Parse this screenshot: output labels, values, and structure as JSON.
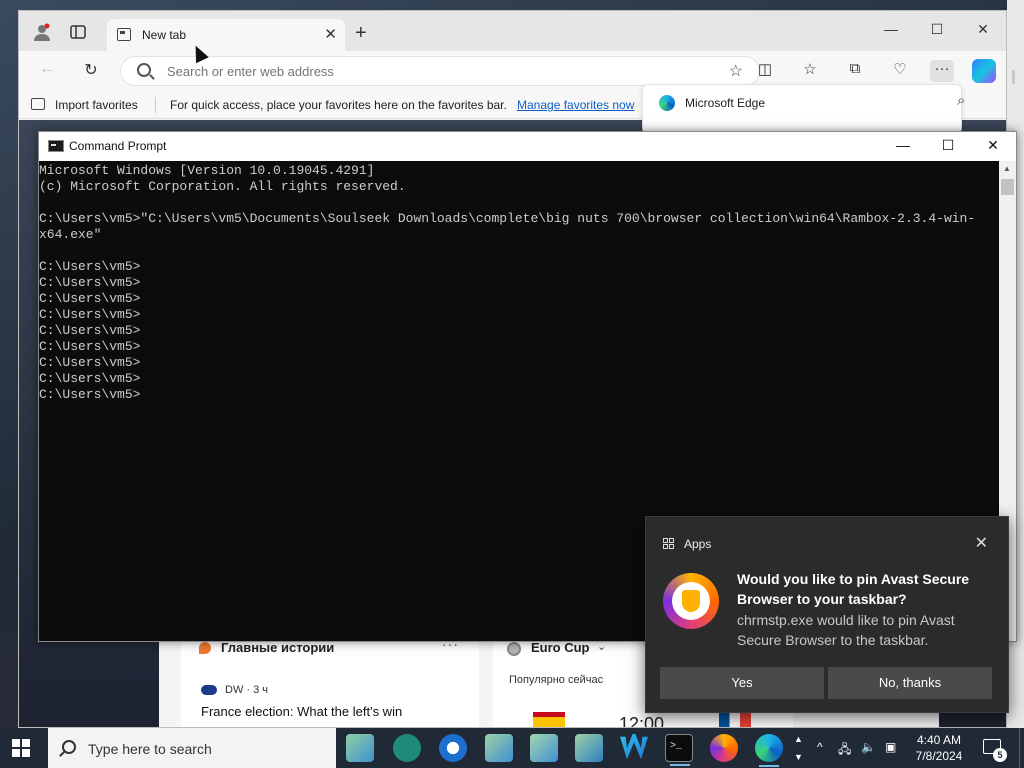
{
  "browser": {
    "tab_title": "New tab",
    "address_placeholder": "Search or enter web address",
    "import_favorites": "Import favorites",
    "favbar_hint": "For quick access, place your favorites here on the favorites bar.",
    "manage_favorites": "Manage favorites now",
    "edge_popup_label": "Microsoft Edge"
  },
  "feed": {
    "top_stories_title": "Главные истории",
    "source": "DW · 3 ч",
    "headline": "France election: What the left's win",
    "euro_title": "Euro Cup",
    "euro_sub": "Популярно сейчас",
    "match_time": "12:00"
  },
  "cmd": {
    "title": "Command Prompt",
    "lines": [
      "Microsoft Windows [Version 10.0.19045.4291]",
      "(c) Microsoft Corporation. All rights reserved.",
      "",
      "C:\\Users\\vm5>\"C:\\Users\\vm5\\Documents\\Soulseek Downloads\\complete\\big nuts 700\\browser collection\\win64\\Rambox-2.3.4-win-",
      "x64.exe\"",
      "",
      "C:\\Users\\vm5>",
      "C:\\Users\\vm5>",
      "C:\\Users\\vm5>",
      "C:\\Users\\vm5>",
      "C:\\Users\\vm5>",
      "C:\\Users\\vm5>",
      "C:\\Users\\vm5>",
      "C:\\Users\\vm5>",
      "C:\\Users\\vm5>"
    ]
  },
  "toast": {
    "app": "Apps",
    "title": "Would you like to pin Avast Secure Browser to your taskbar?",
    "body": "chrmstp.exe would like to pin Avast Secure Browser to the taskbar.",
    "yes": "Yes",
    "no": "No, thanks"
  },
  "taskbar": {
    "search_placeholder": "Type here to search",
    "time": "4:40 AM",
    "date": "7/8/2024",
    "notification_count": "5"
  },
  "colors": {
    "accent": "#0f5fc7",
    "toast_bg": "#2b2b2b",
    "cmd_bg": "#0c0c0c",
    "taskbar_bg": "#1f2a36"
  }
}
